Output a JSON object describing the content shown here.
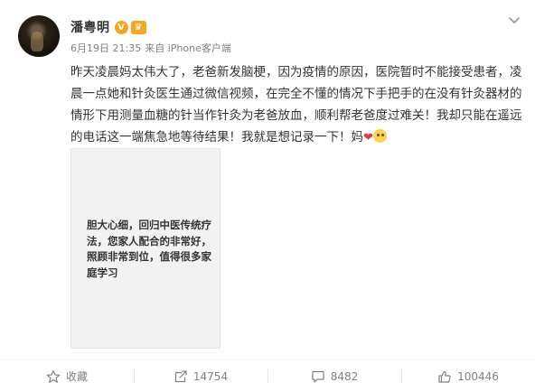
{
  "user": {
    "name": "潘粤明",
    "verified_badge": "V",
    "member_badge": "♛"
  },
  "post": {
    "date": "6月19日 21:35",
    "source": "来自 iPhone客户端",
    "text": "昨天凌晨妈太伟大了，老爸新发脑梗，因为疫情的原因，医院暂时不能接受患者，凌晨一点她和针灸医生通过微信视频，在完全不懂的情况下手把手的在没有针灸器材的情形下用测量血糖的针当作针灸为老爸放血，顺利帮老爸度过难关！我却只能在遥远的电话这一端焦急地等待结果！我就是想记录一下！妈",
    "emoji_heart": "❤",
    "image_text": "胆大心细，回归中医传统疗法，您家人配合的非常好，照顾非常到位，值得很多家庭学习"
  },
  "actions": {
    "favorite_label": "收藏",
    "repost_count": "14754",
    "comment_count": "8482",
    "like_count": "100446"
  },
  "icons": {
    "menu": "chevron-down-icon",
    "favorite": "star-icon",
    "repost": "repost-icon",
    "comment": "comment-icon",
    "like": "thumbs-up-icon"
  },
  "colors": {
    "text": "#333333",
    "meta": "#808080",
    "badge": "#f7a21b",
    "heart": "#e4393c"
  }
}
